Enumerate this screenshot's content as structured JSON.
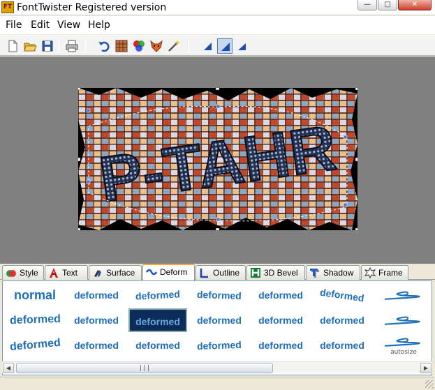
{
  "window": {
    "title": "FontTwister Registered version",
    "app_icon_text": "FT",
    "minimize_glyph": "—",
    "maximize_glyph": "□",
    "close_glyph": "✕"
  },
  "menu": [
    "File",
    "Edit",
    "View",
    "Help"
  ],
  "toolbar": [
    "new-document-icon",
    "open-folder-icon",
    "save-icon",
    "print-icon",
    "undo-icon",
    "texture-icon",
    "colors-icon",
    "fox-icon",
    "magic-wand-icon",
    "align-shape-1-icon",
    "align-shape-2-icon",
    "align-shape-3-icon"
  ],
  "artwork": {
    "text": "P-TAHR"
  },
  "tabs": [
    {
      "label": "Style",
      "icon": "style-icon"
    },
    {
      "label": "Text",
      "icon": "text-icon"
    },
    {
      "label": "Surface",
      "icon": "surface-icon"
    },
    {
      "label": "Deform",
      "icon": "deform-icon",
      "active": true
    },
    {
      "label": "Outline",
      "icon": "outline-icon"
    },
    {
      "label": "3D Bevel",
      "icon": "bevel-icon"
    },
    {
      "label": "Shadow",
      "icon": "shadow-icon"
    },
    {
      "label": "Frame",
      "icon": "frame-icon"
    }
  ],
  "gallery": {
    "rows": [
      [
        "normal",
        "deformed",
        "deformed",
        "deformed",
        "deformed",
        "deformed",
        ""
      ],
      [
        "deformed",
        "deformed",
        "deformed",
        "deformed",
        "deformed",
        "deformed",
        ""
      ],
      [
        "deformed",
        "deformed",
        "deformed",
        "deformed",
        "deformed",
        "deformed",
        "autosize"
      ]
    ],
    "selected": [
      1,
      2
    ]
  },
  "scrollbar": {
    "left_glyph": "◀",
    "right_glyph": "▶",
    "grip": "|||"
  }
}
